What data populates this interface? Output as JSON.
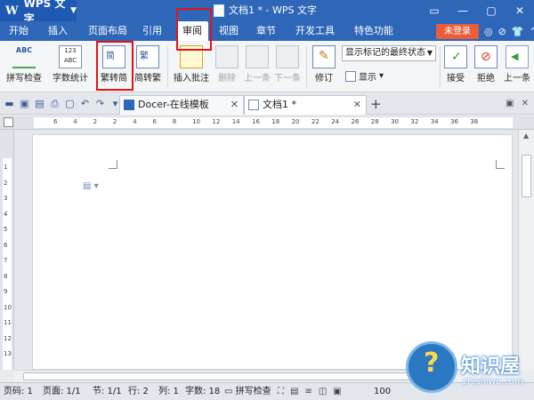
{
  "titlebar": {
    "app_name": "WPS 文字",
    "doc_title": "文档1 * - WPS 文字",
    "controls": [
      "▭",
      "—",
      "▢",
      "✕"
    ]
  },
  "menubar": {
    "tabs": [
      "开始",
      "插入",
      "页面布局",
      "引用",
      "审阅",
      "视图",
      "章节",
      "开发工具",
      "特色功能"
    ],
    "active_tab": "审阅",
    "login_label": "未登录",
    "icons": [
      "◎",
      "⊘",
      "👕",
      "⌃"
    ]
  },
  "ribbon": {
    "spellcheck_label": "拼写检查",
    "spellcheck_icon_text": "ABC",
    "wordcount_label": "字数统计",
    "wordcount_icon_text": "123 ABC",
    "trad_to_simp_label": "繁转简",
    "trad_to_simp_icon_text": "简",
    "simp_to_trad_label": "简转繁",
    "simp_to_trad_icon_text": "繁",
    "insert_comment_label": "插入批注",
    "delete_label": "删除",
    "prev_label": "上一条",
    "next_label": "下一条",
    "markup_select_value": "显示标记的最终状态",
    "track_changes_label": "修订",
    "show_label": "显示",
    "accept_label": "接受",
    "reject_label": "拒绝",
    "prev_change_label": "上一条"
  },
  "tabbar": {
    "tabs": [
      {
        "label": "Docer-在线模板",
        "close": "✕"
      },
      {
        "label": "文档1 *",
        "close": "✕"
      }
    ],
    "add": "+"
  },
  "ruler": {
    "numbers": [
      "6",
      "4",
      "2",
      "2",
      "4",
      "6",
      "8",
      "10",
      "12",
      "14",
      "16",
      "18",
      "20",
      "22",
      "24",
      "26",
      "28",
      "30",
      "32",
      "34",
      "36",
      "38"
    ],
    "vertical_numbers": [
      "1",
      "2",
      "3",
      "4",
      "5",
      "6",
      "7",
      "8",
      "9",
      "10",
      "11",
      "12",
      "13"
    ]
  },
  "statusbar": {
    "page_code": "页码: 1",
    "pages": "页面: 1/1",
    "section": "节: 1/1",
    "row": "行: 2",
    "col": "列: 1",
    "word_count": "字数: 18",
    "spellcheck": "拼写检查",
    "zoom": "100"
  },
  "watermark": {
    "title": "知识屋",
    "subtitle": "zhishiwu.com"
  },
  "colors": {
    "title_blue": "#2f67b8",
    "login_orange": "#e95d3b",
    "highlight_red": "#e2141a"
  }
}
